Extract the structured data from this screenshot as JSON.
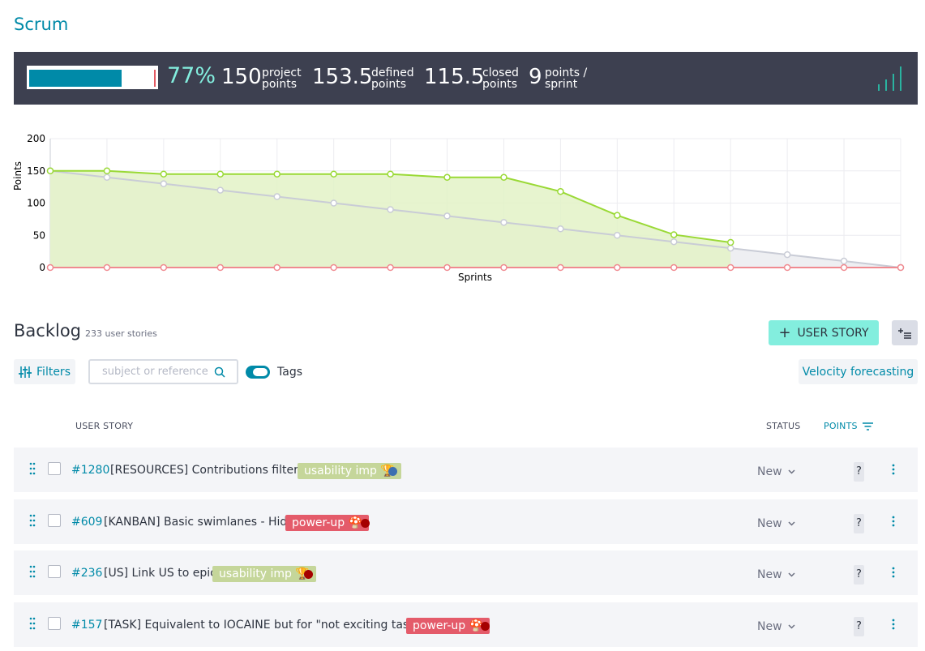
{
  "page": {
    "title": "Scrum"
  },
  "summary": {
    "progress_percent": 77,
    "progress_label": "77%",
    "project_points": "150",
    "project_label_1": "project",
    "project_label_2": "points",
    "defined_points": "153.5",
    "defined_label_1": "defined",
    "defined_label_2": "points",
    "closed_points": "115.5",
    "closed_label_1": "closed",
    "closed_label_2": "points",
    "velocity": "9",
    "velocity_label_1": "points /",
    "velocity_label_2": "sprint",
    "accent_color": "#83eede",
    "bar_color": "#008aa8"
  },
  "chart_data": {
    "type": "area",
    "xlabel": "Sprints",
    "ylabel": "Points",
    "ylim": [
      0,
      200
    ],
    "yticks": [
      0,
      50,
      100,
      150,
      200
    ],
    "x": [
      0,
      1,
      2,
      3,
      4,
      5,
      6,
      7,
      8,
      9,
      10,
      11,
      12,
      13,
      14,
      15
    ],
    "grid": true,
    "series": [
      {
        "name": "",
        "color": "#9ad936",
        "values": [
          150,
          150,
          145,
          145,
          145,
          145,
          145,
          140,
          140,
          118,
          81,
          51,
          39,
          null,
          null,
          null
        ]
      },
      {
        "name": "",
        "color": "#c9ccd6",
        "values": [
          150,
          140,
          130,
          120,
          110,
          100,
          90,
          80,
          70,
          60,
          50,
          40,
          30,
          20,
          10,
          0
        ]
      },
      {
        "name": "",
        "color": "#f08a90",
        "values": [
          0,
          0,
          0,
          0,
          0,
          0,
          0,
          0,
          0,
          0,
          0,
          0,
          0,
          0,
          0,
          0
        ]
      }
    ]
  },
  "backlog": {
    "title": "Backlog",
    "count": "233 user stories",
    "add_button": "USER STORY",
    "filters_button": "Filters",
    "search_placeholder": "subject or reference",
    "tags_label": "Tags",
    "velocity_button": "Velocity forecasting",
    "col_user_story": "USER STORY",
    "col_status": "STATUS",
    "col_points": "POINTS"
  },
  "rows": [
    {
      "ref": "#1280",
      "subject": "[RESOURCES] Contributions filters",
      "tag": "usability imp 🏆",
      "tag_color": "#c5d69a",
      "dot_color": "#3c6fb1",
      "status": "New",
      "points": "?"
    },
    {
      "ref": "#609",
      "subject": "[KANBAN] Basic swimlanes - Hide",
      "tag": "power-up 🍄",
      "tag_color": "#e45b6a",
      "dot_color": "#a50000",
      "status": "New",
      "points": "?"
    },
    {
      "ref": "#236",
      "subject": "[US] Link US to epic",
      "tag": "usability imp 🏆",
      "tag_color": "#c5d69a",
      "dot_color": "#a50000",
      "status": "New",
      "points": "?"
    },
    {
      "ref": "#157",
      "subject": "[TASK] Equivalent to IOCAINE but for \"not exciting tasks\"",
      "tag": "power-up 🍄",
      "tag_color": "#e45b6a",
      "dot_color": "#a50000",
      "status": "New",
      "points": "?"
    }
  ]
}
